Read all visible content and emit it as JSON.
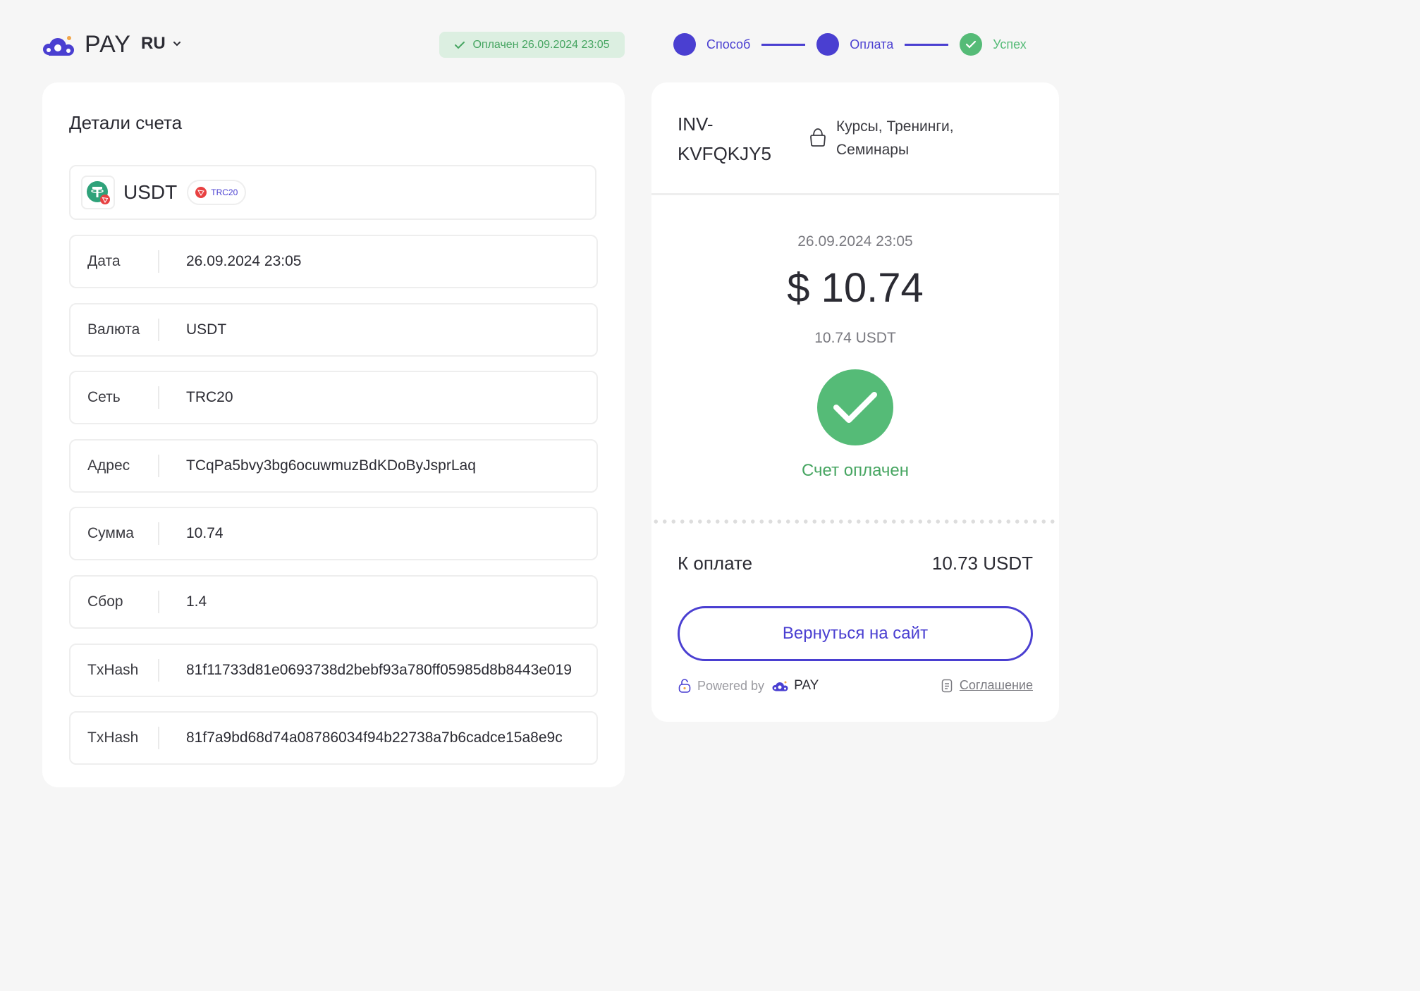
{
  "header": {
    "brand": "PAY",
    "language": "RU",
    "status_badge": "Оплачен 26.09.2024 23:05",
    "steps": [
      {
        "label": "Способ"
      },
      {
        "label": "Оплата"
      },
      {
        "label": "Успех"
      }
    ]
  },
  "details": {
    "title": "Детали счета",
    "asset": "USDT",
    "network_chip": "TRC20",
    "rows": [
      {
        "label": "Дата",
        "value": "26.09.2024 23:05"
      },
      {
        "label": "Валюта",
        "value": "USDT"
      },
      {
        "label": "Сеть",
        "value": "TRC20"
      },
      {
        "label": "Адрес",
        "value": "TCqPa5bvy3bg6ocuwmuzBdKDoByJsprLaq"
      },
      {
        "label": "Сумма",
        "value": "10.74"
      },
      {
        "label": "Сбор",
        "value": "1.4"
      },
      {
        "label": "TxHash",
        "value": "81f11733d81e0693738d2bebf93a780ff05985d8b8443e019"
      },
      {
        "label": "TxHash",
        "value": "81f7a9bd68d74a08786034f94b22738a7b6cadce15a8e9c"
      }
    ]
  },
  "summary": {
    "invoice_id": "INV-KVFQKJY5",
    "category": "Курсы, Тренинги, Семинары",
    "date": "26.09.2024 23:05",
    "amount": "$ 10.74",
    "amount_crypto": "10.74 USDT",
    "status": "Счет оплачен",
    "to_pay_label": "К оплате",
    "to_pay_value": "10.73 USDT",
    "return_button": "Вернуться на сайт",
    "powered_by": "Powered by",
    "powered_brand": "PAY",
    "agreement": "Соглашение"
  },
  "colors": {
    "accent": "#4a3fd1",
    "success": "#55bb77",
    "background": "#f6f6f6"
  },
  "icons": [
    "cloud-logo-icon",
    "chevron-down-icon",
    "check-icon",
    "tether-icon",
    "tron-icon",
    "bag-icon",
    "lock-icon",
    "document-icon"
  ]
}
